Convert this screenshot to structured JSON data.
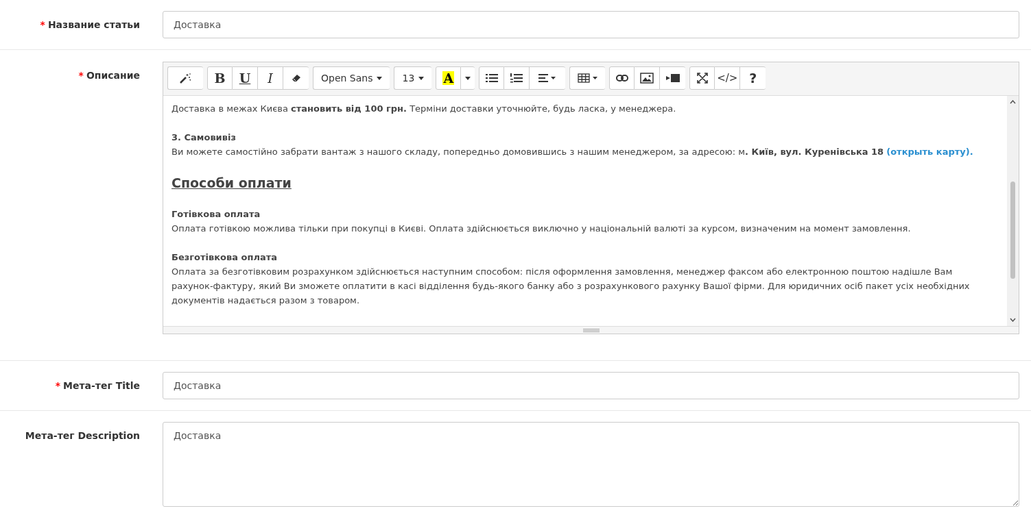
{
  "fields": [
    {
      "kind": "input",
      "required_mark": "*",
      "label": "Название статьи",
      "value": "Доставка"
    },
    {
      "kind": "editor",
      "required_mark": "*",
      "label": "Описание"
    },
    {
      "kind": "input",
      "required_mark": "*",
      "label": "Мета-тег Title",
      "value": "Доставка"
    },
    {
      "kind": "textarea",
      "label": "Мета-тег Description",
      "value": "Доставка"
    }
  ],
  "editor": {
    "toolbar": [
      [
        {
          "kind": "magic"
        }
      ],
      [
        {
          "kind": "bold",
          "text": "B"
        },
        {
          "kind": "underline",
          "text": "U"
        },
        {
          "kind": "italic",
          "text": "I"
        },
        {
          "kind": "eraser"
        }
      ],
      [
        {
          "kind": "select",
          "text": "Open Sans"
        }
      ],
      [
        {
          "kind": "select",
          "text": "13"
        }
      ],
      [
        {
          "kind": "color",
          "text": "A"
        },
        {
          "kind": "caret"
        }
      ],
      [
        {
          "kind": "ul"
        },
        {
          "kind": "ol"
        },
        {
          "kind": "align"
        }
      ],
      [
        {
          "kind": "table"
        }
      ],
      [
        {
          "kind": "link"
        },
        {
          "kind": "image"
        },
        {
          "kind": "video"
        }
      ],
      [
        {
          "kind": "fullscreen"
        },
        {
          "kind": "code",
          "text": "</>"
        },
        {
          "kind": "help",
          "text": "?"
        }
      ]
    ],
    "content": [
      {
        "kind": "paragraph",
        "text": "Доставка в межах Києва **становить від 100 грн.** Терміни доставки уточнюйте, будь ласка, у менеджера."
      },
      {
        "kind": "subheading",
        "text": "3. Самовивіз"
      },
      {
        "kind": "paragraph",
        "text": "Ви можете самостійно забрати вантаж з нашого складу, попередньо домовившись з нашим менеджером, за адресою: м**. Київ, вул. Куренівська 18**",
        "link": "(открыть карту)."
      },
      {
        "kind": "heading",
        "text": "Способи оплати"
      },
      {
        "kind": "subheading",
        "text": "Готівкова оплата"
      },
      {
        "kind": "paragraph",
        "text": "Оплата готівкою можлива тільки при покупці в Києві. Оплата здійснюється виключно у національній валюті за курсом, визначеним на момент замовлення."
      },
      {
        "kind": "subheading",
        "text": "Безготівкова оплата"
      },
      {
        "kind": "paragraph",
        "text": "Оплата за безготівковим розрахунком здійснюється наступним способом: після оформлення замовлення, менеджер факсом або електронною поштою надішле Вам рахунок-фактуру, який Ви зможете оплатити в касі відділення будь-якого банку або з розрахункового рахунку Вашої фірми. Для юридичних осіб пакет усіх необхідних документів надається разом з товаром."
      }
    ]
  }
}
